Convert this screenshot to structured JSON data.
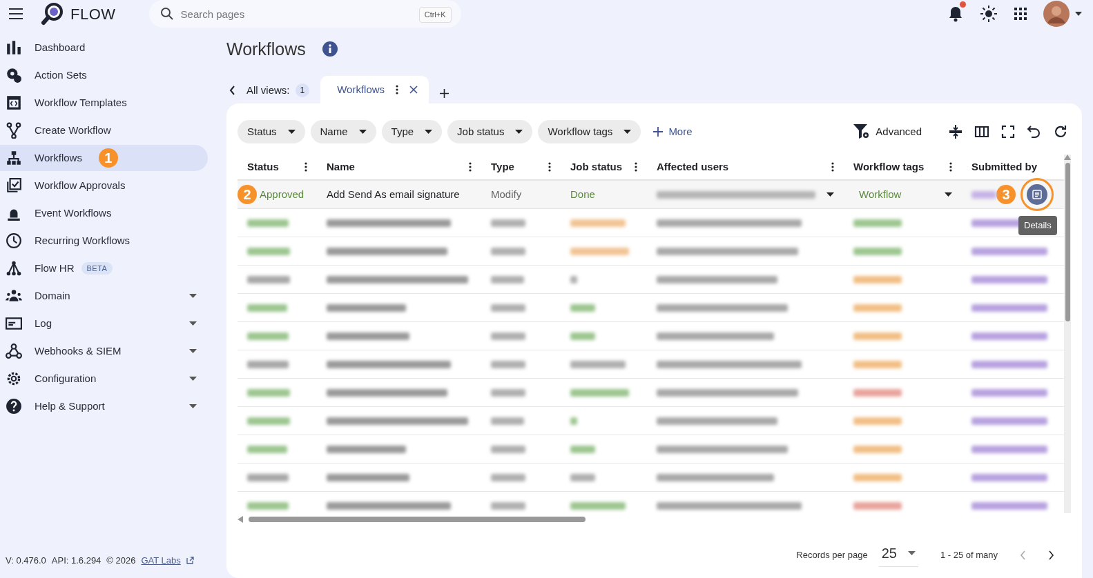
{
  "app": {
    "name": "FLOW",
    "search": {
      "placeholder": "Search pages",
      "shortcut": "Ctrl+K"
    },
    "notifications": {
      "unread": true
    }
  },
  "sidebar": {
    "items": [
      {
        "label": "Dashboard",
        "selected": false,
        "expandable": false
      },
      {
        "label": "Action Sets",
        "selected": false,
        "expandable": false
      },
      {
        "label": "Workflow Templates",
        "selected": false,
        "expandable": false
      },
      {
        "label": "Create Workflow",
        "selected": false,
        "expandable": false
      },
      {
        "label": "Workflows",
        "selected": true,
        "expandable": false,
        "callout": "1"
      },
      {
        "label": "Workflow Approvals",
        "selected": false,
        "expandable": false
      },
      {
        "label": "Event Workflows",
        "selected": false,
        "expandable": false
      },
      {
        "label": "Recurring Workflows",
        "selected": false,
        "expandable": false
      },
      {
        "label": "Flow HR",
        "selected": false,
        "expandable": false,
        "badge": "BETA"
      },
      {
        "label": "Domain",
        "selected": false,
        "expandable": true
      },
      {
        "label": "Log",
        "selected": false,
        "expandable": true
      },
      {
        "label": "Webhooks & SIEM",
        "selected": false,
        "expandable": true
      },
      {
        "label": "Configuration",
        "selected": false,
        "expandable": true
      },
      {
        "label": "Help & Support",
        "selected": false,
        "expandable": true
      }
    ],
    "footer": {
      "version": "V: 0.476.0",
      "api": "API: 1.6.294",
      "copyright": "© 2026",
      "link": "GAT Labs"
    }
  },
  "page": {
    "title": "Workflows"
  },
  "views": {
    "label": "All views:",
    "count": "1",
    "tabs": [
      {
        "label": "Workflows",
        "selected": true
      }
    ]
  },
  "filters": [
    "Status",
    "Name",
    "Type",
    "Job status",
    "Workflow tags"
  ],
  "more": "More",
  "advanced": "Advanced",
  "table": {
    "columns": [
      "Status",
      "Name",
      "Type",
      "Job status",
      "Affected users",
      "Workflow tags",
      "Submitted by"
    ],
    "first_row": {
      "status": "Approved",
      "name": "Add Send As email signature",
      "type": "Modify",
      "job_status": "Done",
      "tag": "Workflow",
      "callout": "2",
      "details": {
        "tooltip": "Details",
        "callout": "3"
      }
    },
    "blurred_rows": [
      {
        "status": {
          "color": "#9cc690"
        },
        "job_status": {
          "color": "#f2c494"
        },
        "tag": {
          "color": "#9cc690"
        }
      },
      {
        "status": {
          "color": "#9cc690"
        },
        "job_status": {
          "color": "#f2c494"
        },
        "tag": {
          "color": "#9cc690"
        }
      },
      {
        "status": {
          "color": "#a8a8a8"
        },
        "job_status": {
          "color": "#b0b0b0"
        },
        "tag": {
          "color": "#f2bf85"
        }
      },
      {
        "status": {
          "color": "#9cc690"
        },
        "job_status": {
          "color": "#9cc690"
        },
        "tag": {
          "color": "#f2bf85"
        }
      },
      {
        "status": {
          "color": "#9cc690"
        },
        "job_status": {
          "color": "#9cc690"
        },
        "tag": {
          "color": "#f2bf85"
        }
      },
      {
        "status": {
          "color": "#a8a8a8"
        },
        "job_status": {
          "color": "#b0b0b0"
        },
        "tag": {
          "color": "#f2bf85"
        }
      },
      {
        "status": {
          "color": "#9cc690"
        },
        "job_status": {
          "color": "#9cc690"
        },
        "tag": {
          "color": "#e8a49c"
        }
      },
      {
        "status": {
          "color": "#9cc690"
        },
        "job_status": {
          "color": "#9cc690"
        },
        "tag": {
          "color": "#f2bf85"
        }
      },
      {
        "status": {
          "color": "#9cc690"
        },
        "job_status": {
          "color": "#9cc690"
        },
        "tag": {
          "color": "#f2bf85"
        }
      },
      {
        "status": {
          "color": "#a8a8a8"
        },
        "job_status": {
          "color": "#b0b0b0"
        },
        "tag": {
          "color": "#f2bf85"
        }
      },
      {
        "status": {
          "color": "#9cc690"
        },
        "job_status": {
          "color": "#9cc690"
        },
        "tag": {
          "color": "#e8a49c"
        }
      }
    ]
  },
  "pagination": {
    "label": "Records per page",
    "per_page": "25",
    "range": "1 - 25 of many"
  }
}
